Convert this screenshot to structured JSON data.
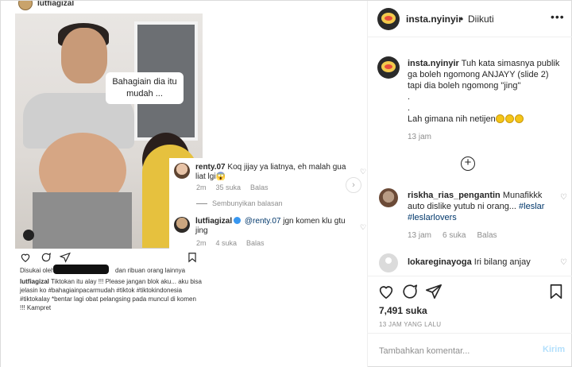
{
  "screenshot": {
    "username": "lutfiagizal",
    "speech_bubble": "Bahagiain dia itu\nmudah ...",
    "comments": [
      {
        "user": "renty.07",
        "text": "Koq jijay ya liatnya, eh malah gua liat lgi😱",
        "time": "2m",
        "likes": "35 suka",
        "reply": "Balas"
      },
      {
        "user": "lutfiagizal",
        "mention": "@renty.07",
        "text": "jgn komen klu gtu jing",
        "time": "2m",
        "likes": "4 suka",
        "reply": "Balas"
      }
    ],
    "hide_replies": "Sembunyikan balasan",
    "likes_text": "Disukai oleh",
    "likes_text_2": "dan ribuan orang lainnya",
    "caption_user": "lutfiagizal",
    "caption": "Tiktokan itu alay !!! Please jangan blok aku... aku bisa jelasin ko #bahagiainpacarmudah #tiktok #tiktokindonesia #tiktokalay *bentar lagi obat pelangsing pada muncul di komen !!! Kampret"
  },
  "header": {
    "username": "insta.nyinyir",
    "separator": "•",
    "follow_status": "Diikuti",
    "more": "•••"
  },
  "comments": [
    {
      "username": "insta.nyinyir",
      "text_1": "Tuh kata simasnya publik ga boleh ngomong ANJAYY (slide 2) tapi dia boleh ngomong \"jing\"",
      "text_2": ".",
      "text_3": ".",
      "text_4": "Lah gimana nih netijen",
      "time": "13 jam"
    },
    {
      "username": "riskha_rias_pengantin",
      "text": "Munafikkk auto dislike yutub ni orang...",
      "tags": "#leslar #leslarlovers",
      "time": "13 jam",
      "likes": "6 suka",
      "reply": "Balas"
    },
    {
      "username": "lokareginayoga",
      "text": "Iri bilang anjay"
    }
  ],
  "actions": {
    "likes": "7,491 suka",
    "timestamp": "13 JAM YANG LALU"
  },
  "add_comment": {
    "placeholder": "Tambahkan komentar...",
    "post_label": "Kirim"
  }
}
